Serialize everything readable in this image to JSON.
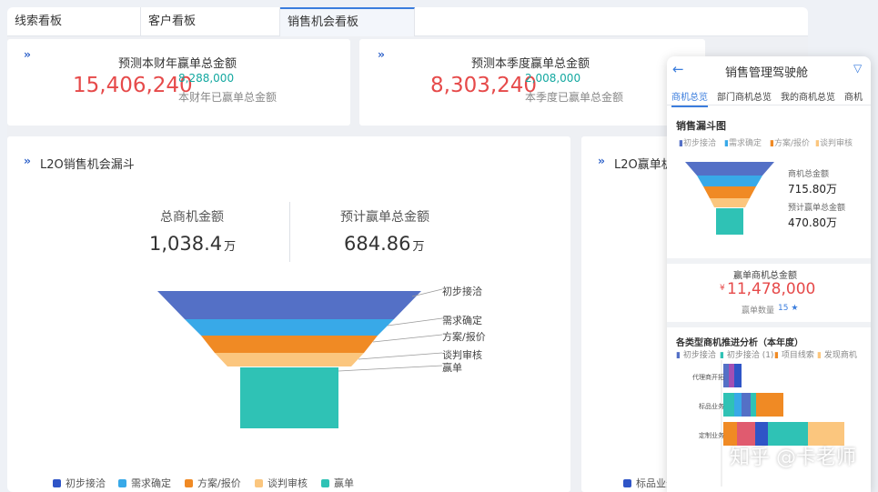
{
  "tabs": [
    "线索看板",
    "客户看板",
    "销售机会看板"
  ],
  "kpi1": {
    "title": "预测本财年赢单总金额",
    "value": "15,406,240",
    "sub_value": "8,288,000",
    "sub_label": "本财年已赢单总金额"
  },
  "kpi2": {
    "title": "预测本季度赢单总金额",
    "value": "8,303,240",
    "sub_value": "2,008,000",
    "sub_label": "本季度已赢单总金额"
  },
  "funnel_panel": {
    "title": "L2O销售机会漏斗",
    "total_label": "总商机金额",
    "total_value": "1,038.4",
    "total_unit": "万",
    "expected_label": "预计赢单总金额",
    "expected_value": "684.86",
    "expected_unit": "万",
    "stages": [
      "初步接洽",
      "需求确定",
      "方案/报价",
      "谈判审核",
      "赢单"
    ],
    "legend": [
      "初步接洽",
      "需求确定",
      "方案/报价",
      "谈判审核",
      "赢单"
    ]
  },
  "right_panel": {
    "title": "L2O赢单机",
    "legend_item": "标品业务"
  },
  "colors": {
    "stage1": "#5470c6",
    "stage2": "#38a9e8",
    "stage3": "#f08a24",
    "stage4": "#fbc67e",
    "stage5": "#2fc2b5",
    "accent": "#3b7ddd",
    "red": "#e64a4a"
  },
  "phone": {
    "title": "销售管理驾驶舱",
    "tabs": [
      "商机总览",
      "部门商机总览",
      "我的商机总览",
      "商机"
    ],
    "funnel_title": "销售漏斗图",
    "funnel_legend": [
      "初步接洽",
      "需求确定",
      "方案/报价",
      "谈判审核"
    ],
    "total_label": "商机总金额",
    "total_value": "715.80万",
    "expected_label": "预计赢单总金额",
    "expected_value": "470.80万",
    "won_label": "赢单商机总金额",
    "won_currency": "¥",
    "won_value": "11,478,000",
    "won_count_label": "赢单数量",
    "won_count": "15",
    "analysis_title": "各类型商机推进分析（本年度）",
    "analysis_legend": [
      "初步接洽",
      "初步接洽 (1)",
      "项目线索",
      "发现商机"
    ],
    "analysis_categories": [
      "代理商开拓",
      "标品业务",
      "定制业务"
    ]
  },
  "watermark": "知乎 @卡老师"
}
